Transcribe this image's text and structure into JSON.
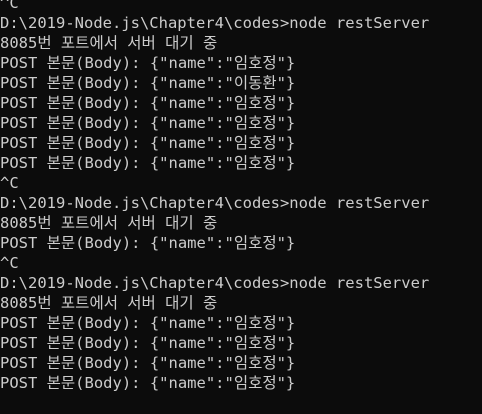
{
  "terminal": {
    "text_color": "#cccccc",
    "background_color": "#0c0c0c",
    "lines": [
      "^C",
      "D:\\2019-Node.js\\Chapter4\\codes>node restServer",
      "8085번 포트에서 서버 대기 중",
      "POST 본문(Body): {\"name\":\"임호정\"}",
      "POST 본문(Body): {\"name\":\"이동환\"}",
      "POST 본문(Body): {\"name\":\"임호정\"}",
      "POST 본문(Body): {\"name\":\"임호정\"}",
      "POST 본문(Body): {\"name\":\"임호정\"}",
      "POST 본문(Body): {\"name\":\"임호정\"}",
      "^C",
      "D:\\2019-Node.js\\Chapter4\\codes>node restServer",
      "8085번 포트에서 서버 대기 중",
      "POST 본문(Body): {\"name\":\"임호정\"}",
      "^C",
      "D:\\2019-Node.js\\Chapter4\\codes>node restServer",
      "8085번 포트에서 서버 대기 중",
      "POST 본문(Body): {\"name\":\"임호정\"}",
      "POST 본문(Body): {\"name\":\"임호정\"}",
      "POST 본문(Body): {\"name\":\"임호정\"}",
      "POST 본문(Body): {\"name\":\"임호정\"}"
    ]
  }
}
